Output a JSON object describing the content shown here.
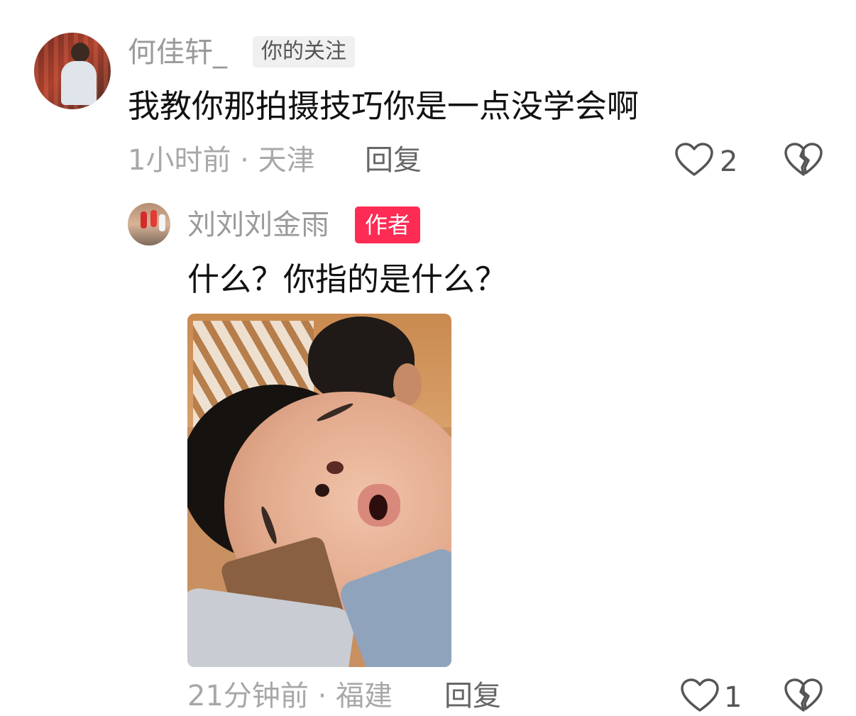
{
  "comment": {
    "username": "何佳轩_",
    "follow_badge": "你的关注",
    "text": "我教你那拍摄技巧你是一点没学会啊",
    "meta": "1小时前 · 天津",
    "reply_label": "回复",
    "like_count": "2",
    "icons": {
      "like": "heart-outline-icon",
      "dislike": "broken-heart-icon"
    }
  },
  "reply": {
    "username": "刘刘刘金雨",
    "author_badge": "作者",
    "text": "什么？你指的是什么？",
    "meta": "21分钟前 · 福建",
    "reply_label": "回复",
    "like_count": "1",
    "icons": {
      "like": "heart-outline-icon",
      "dislike": "broken-heart-icon"
    }
  },
  "colors": {
    "author_badge_bg": "#fe2c55",
    "follow_badge_bg": "#f0f0f0",
    "meta_text": "#a8a8a8",
    "username_text": "#9a9a9a",
    "body_text": "#111111"
  }
}
